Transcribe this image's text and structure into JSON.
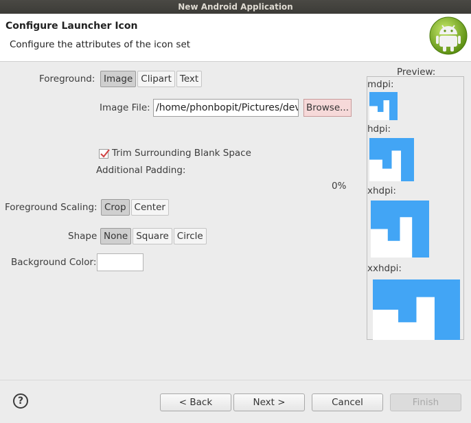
{
  "window": {
    "title": "New Android Application"
  },
  "header": {
    "title": "Configure Launcher Icon",
    "description": "Configure the attributes of the icon set"
  },
  "form": {
    "foreground": {
      "label": "Foreground:",
      "options": [
        "Image",
        "Clipart",
        "Text"
      ],
      "selected": "Image"
    },
    "image_file": {
      "label": "Image File:",
      "value": "/home/phonbopit/Pictures/dev",
      "browse_label": "Browse..."
    },
    "trim": {
      "label": "Trim Surrounding Blank Space",
      "checked": true
    },
    "padding": {
      "label": "Additional Padding:",
      "value": "0%"
    },
    "scaling": {
      "label": "Foreground Scaling:",
      "options": [
        "Crop",
        "Center"
      ],
      "selected": "Crop"
    },
    "shape": {
      "label": "Shape",
      "options": [
        "None",
        "Square",
        "Circle"
      ],
      "selected": "None"
    },
    "background_color": {
      "label": "Background Color:",
      "value": "#ffffff"
    }
  },
  "preview": {
    "title": "Preview:",
    "densities": [
      "mdpi:",
      "hdpi:",
      "xhdpi:",
      "xxhdpi:"
    ],
    "icon_color": "#42a5f5"
  },
  "footer": {
    "help_icon": "?",
    "back_label": "< Back",
    "next_label": "Next >",
    "cancel_label": "Cancel",
    "finish_label": "Finish"
  }
}
